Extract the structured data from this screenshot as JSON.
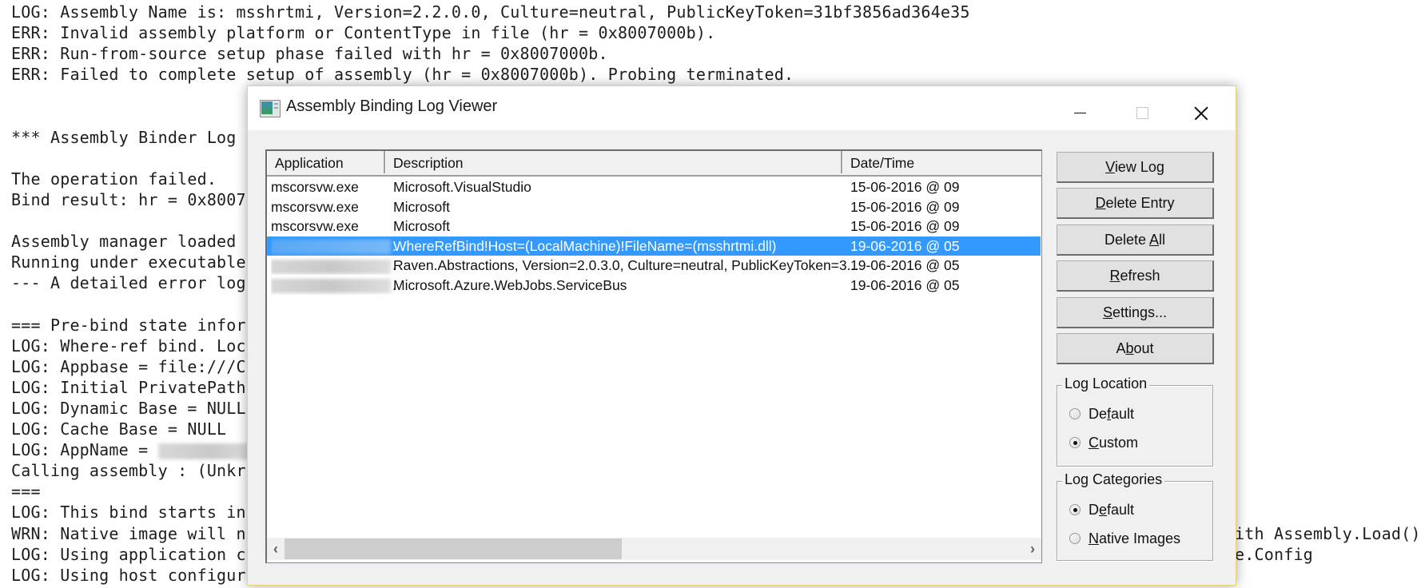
{
  "console": {
    "lines": [
      "LOG: Assembly Name is: msshrtmi, Version=2.2.0.0, Culture=neutral, PublicKeyToken=31bf3856ad364e35",
      "ERR: Invalid assembly platform or ContentType in file (hr = 0x8007000b).",
      "ERR: Run-from-source setup phase failed with hr = 0x8007000b.",
      "ERR: Failed to complete setup of assembly (hr = 0x8007000b). Probing terminated.",
      "",
      "",
      "*** Assembly Binder Log",
      "",
      "The operation failed.",
      "Bind result: hr = 0x8007",
      "",
      "Assembly manager loaded",
      "Running under executable",
      "--- A detailed error log",
      "",
      "=== Pre-bind state infor",
      "LOG: Where-ref bind. Loc",
      "LOG: Appbase = file:///C",
      "LOG: Initial PrivatePath",
      "LOG: Dynamic Base = NULL",
      "LOG: Cache Base = NULL",
      "LOG: AppName = ",
      "Calling assembly : (Unkr",
      "===",
      "LOG: This bind starts in",
      "WRN: Native image will n",
      "LOG: Using application c",
      "LOG: Using host configur"
    ],
    "appname_suffix": ".",
    "right_tails": {
      "wrn": "ith Assembly.Load()",
      "config": "e.Config"
    }
  },
  "window": {
    "title": "Assembly Binding Log Viewer",
    "controls": {
      "minimize": "minimize",
      "maximize": "maximize",
      "close": "close"
    }
  },
  "list": {
    "columns": [
      "Application",
      "Description",
      "Date/Time"
    ],
    "rows": [
      {
        "app": "mscorsvw.exe",
        "app_blurred": false,
        "desc": "Microsoft.VisualStudio",
        "date": "15-06-2016 @ 09",
        "selected": false
      },
      {
        "app": "mscorsvw.exe",
        "app_blurred": false,
        "desc": "Microsoft",
        "date": "15-06-2016 @ 09",
        "selected": false
      },
      {
        "app": "mscorsvw.exe",
        "app_blurred": false,
        "desc": "Microsoft",
        "date": "15-06-2016 @ 09",
        "selected": false
      },
      {
        "app": ".",
        "app_blurred": true,
        "desc": "WhereRefBind!Host=(LocalMachine)!FileName=(msshrtmi.dll)",
        "date": "19-06-2016 @ 05",
        "selected": true
      },
      {
        "app": ".",
        "app_blurred": true,
        "desc": "Raven.Abstractions, Version=2.0.3.0, Culture=neutral, PublicKeyToken=3...",
        "date": "19-06-2016 @ 05",
        "selected": false
      },
      {
        "app": ".",
        "app_blurred": true,
        "desc": "Microsoft.Azure.WebJobs.ServiceBus",
        "date": "19-06-2016 @ 05",
        "selected": false
      }
    ],
    "scroll_left": "‹",
    "scroll_right": "›",
    "selection_color": "#3399ff"
  },
  "buttons": [
    {
      "pre": "",
      "u": "V",
      "post": "iew Log"
    },
    {
      "pre": "",
      "u": "D",
      "post": "elete Entry"
    },
    {
      "pre": "Delete ",
      "u": "A",
      "post": "ll"
    },
    {
      "pre": "",
      "u": "R",
      "post": "efresh"
    },
    {
      "pre": "",
      "u": "S",
      "post": "ettings..."
    },
    {
      "pre": "A",
      "u": "b",
      "post": "out"
    }
  ],
  "log_location": {
    "label": "Log Location",
    "options": [
      {
        "pre": "De",
        "u": "f",
        "post": "ault",
        "checked": false
      },
      {
        "pre": "",
        "u": "C",
        "post": "ustom",
        "checked": true
      }
    ]
  },
  "log_categories": {
    "label": "Log Categories",
    "options": [
      {
        "pre": "D",
        "u": "e",
        "post": "fault",
        "checked": true
      },
      {
        "pre": "",
        "u": "N",
        "post": "ative Images",
        "checked": false
      }
    ]
  }
}
